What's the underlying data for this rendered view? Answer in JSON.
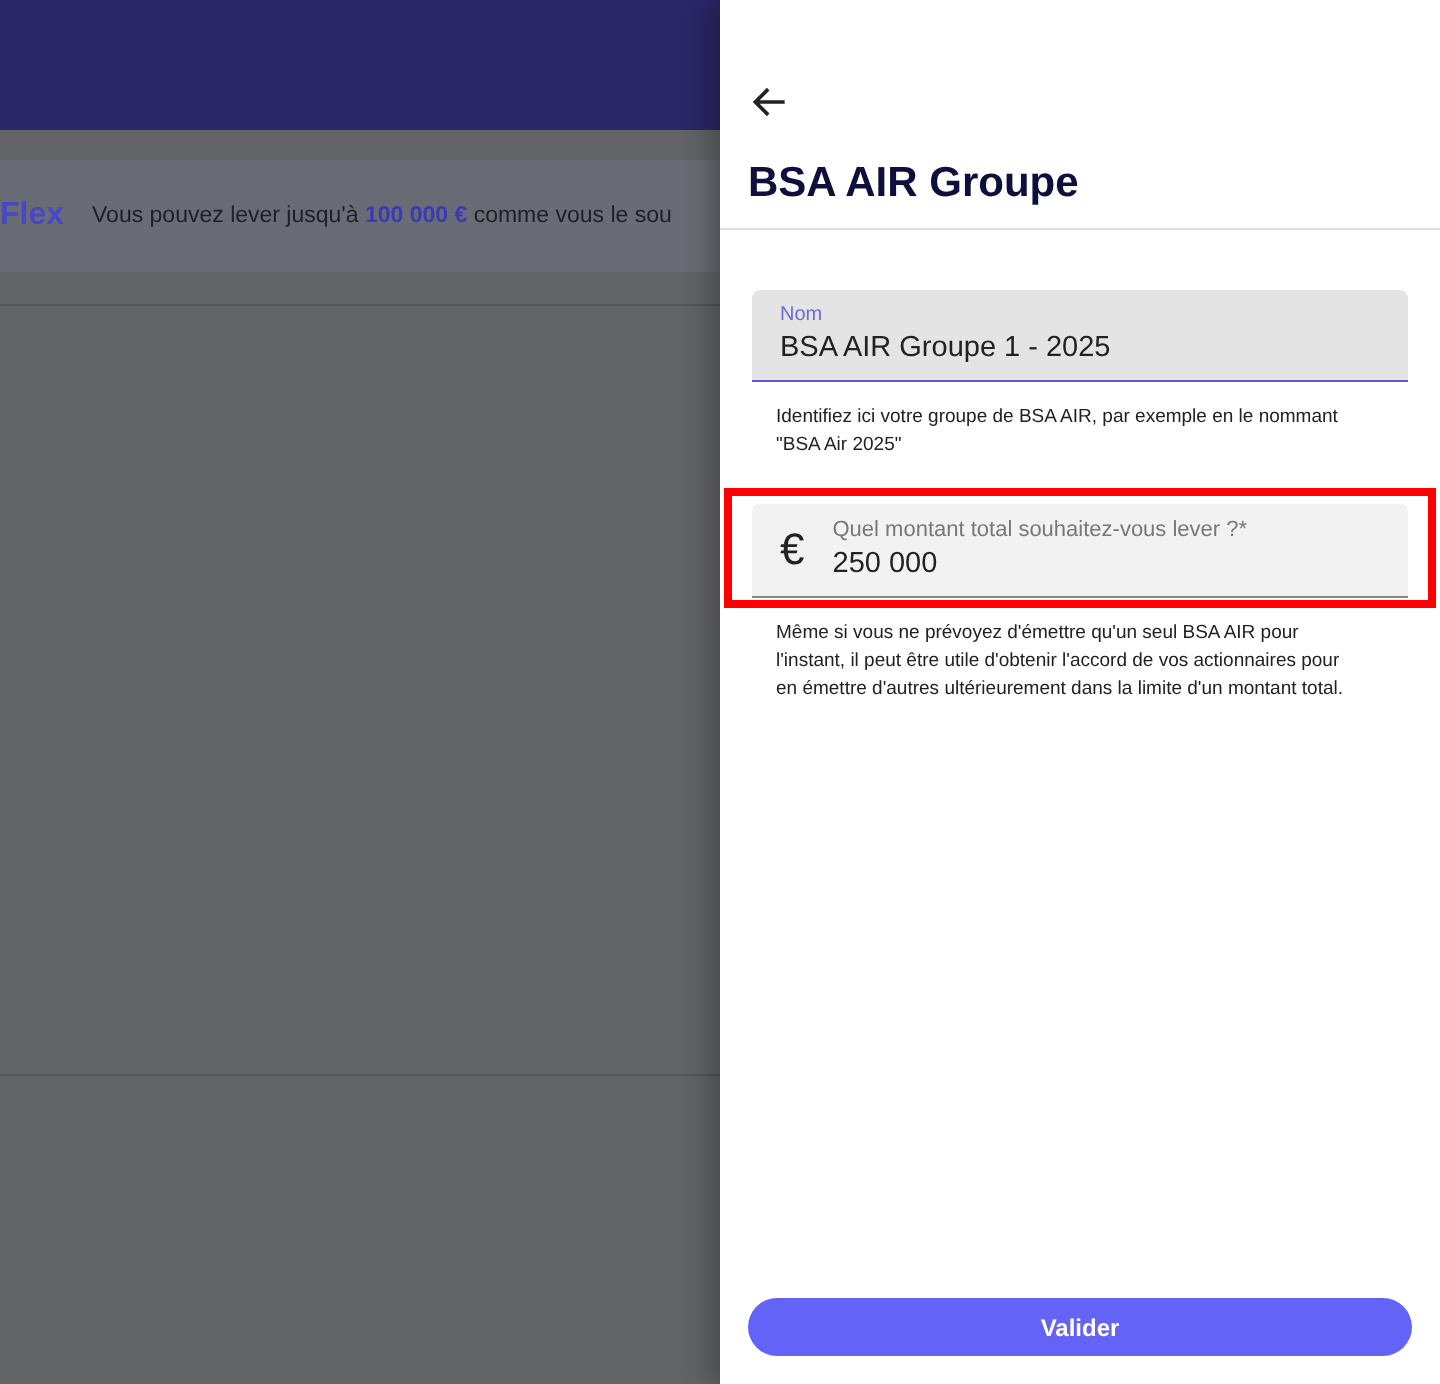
{
  "background_page": {
    "banner": {
      "title": "Flex",
      "text": "Vous pouvez lever jusqu'à **100 000 €** comme vous le sou"
    }
  },
  "panel": {
    "title": "BSA AIR Groupe",
    "fields": [
      {
        "kind": "text",
        "label": "Nom",
        "value": "BSA AIR Groupe 1 - 2025",
        "focused": true,
        "highlighted": false,
        "help": "Identifiez ici votre groupe de BSA AIR, par exemple en le nommant \"BSA Air 2025\""
      },
      {
        "kind": "currency",
        "prefix": "€",
        "label": "Quel montant total souhaitez-vous lever ?*",
        "value": "250 000",
        "focused": false,
        "highlighted": true,
        "help": " Même si vous ne prévoyez d'émettre qu'un seul BSA AIR pour l'instant, il peut être utile d'obtenir l'accord de vos actionnaires pour en émettre d'autres ultérieurement dans la limite d'un montant total."
      }
    ],
    "submit": "Valider"
  }
}
